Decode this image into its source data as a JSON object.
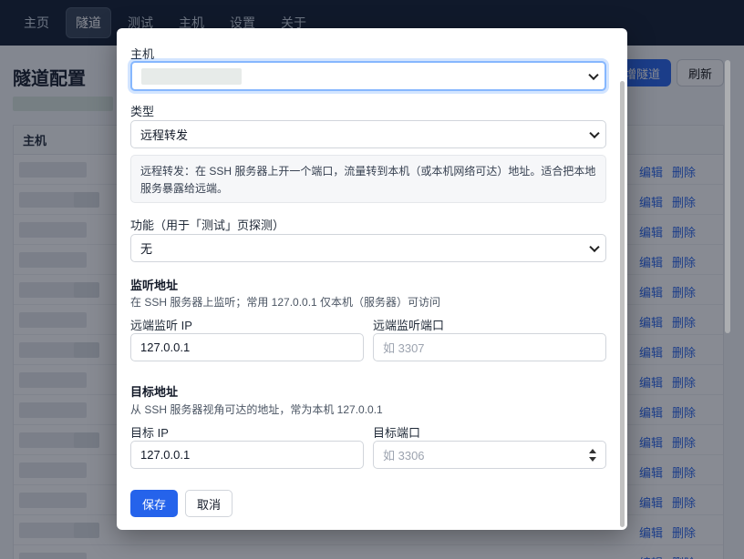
{
  "nav": {
    "items": [
      {
        "label": "主页"
      },
      {
        "label": "隧道",
        "active": true
      },
      {
        "label": "测试"
      },
      {
        "label": "主机"
      },
      {
        "label": "设置"
      },
      {
        "label": "关于"
      }
    ]
  },
  "page": {
    "title": "隧道配置",
    "add_button": "增隧道",
    "refresh_button": "刷新",
    "table_header_host": "主机",
    "row_edit": "编辑",
    "row_delete": "删除"
  },
  "modal": {
    "host_label": "主机",
    "type_label": "类型",
    "type_value": "远程转发",
    "type_help": "远程转发：在 SSH 服务器上开一个端口，流量转到本机（或本机网络可达）地址。适合把本地服务暴露给远端。",
    "feature_label": "功能（用于「测试」页探测）",
    "feature_value": "无",
    "listen_title": "监听地址",
    "listen_desc": "在 SSH 服务器上监听；常用 127.0.0.1 仅本机（服务器）可访问",
    "remote_ip_label": "远端监听 IP",
    "remote_ip_value": "127.0.0.1",
    "remote_port_label": "远端监听端口",
    "remote_port_placeholder": "如 3307",
    "target_title": "目标地址",
    "target_desc": "从 SSH 服务器视角可达的地址，常为本机 127.0.0.1",
    "target_ip_label": "目标 IP",
    "target_ip_value": "127.0.0.1",
    "target_port_label": "目标端口",
    "target_port_placeholder": "如 3306",
    "save_button": "保存",
    "cancel_button": "取消"
  },
  "colors": {
    "primary": "#2563eb",
    "nav_bg": "#0f1a2e",
    "focus_ring": "#86b7fe"
  }
}
